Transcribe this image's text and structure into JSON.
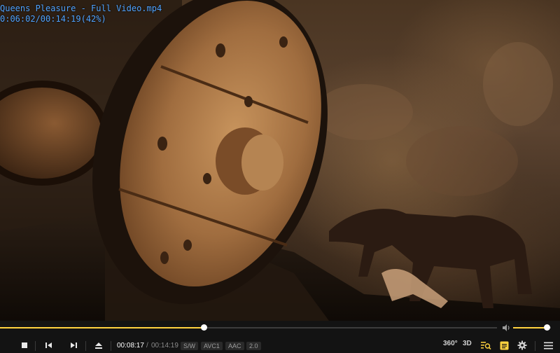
{
  "osd": {
    "title": "Queens Pleasure - Full Video.mp4",
    "time_line": "0:06:02/00:14:19(42%)"
  },
  "playback": {
    "current_time": "00:08:17",
    "separator": "/",
    "total_time": "00:14:19",
    "progress_fraction": 0.41,
    "volume_fraction": 0.88
  },
  "badges": {
    "renderer": "S/W",
    "video_codec": "AVC1",
    "audio_codec": "AAC",
    "channels": "2.0"
  },
  "right_buttons": {
    "vr_label": "360°",
    "stereo_label": "3D"
  },
  "icons": {
    "stop": "stop-icon",
    "prev": "skip-previous-icon",
    "next": "skip-next-icon",
    "eject": "eject-icon",
    "volume": "speaker-icon",
    "playlist_search": "playlist-search-icon",
    "subtitles": "subtitle-icon",
    "settings": "gear-icon",
    "menu": "hamburger-menu-icon"
  },
  "colors": {
    "accent": "#ffd23f",
    "osd_text": "#4fa3ff",
    "bar_bg": "#131313"
  }
}
